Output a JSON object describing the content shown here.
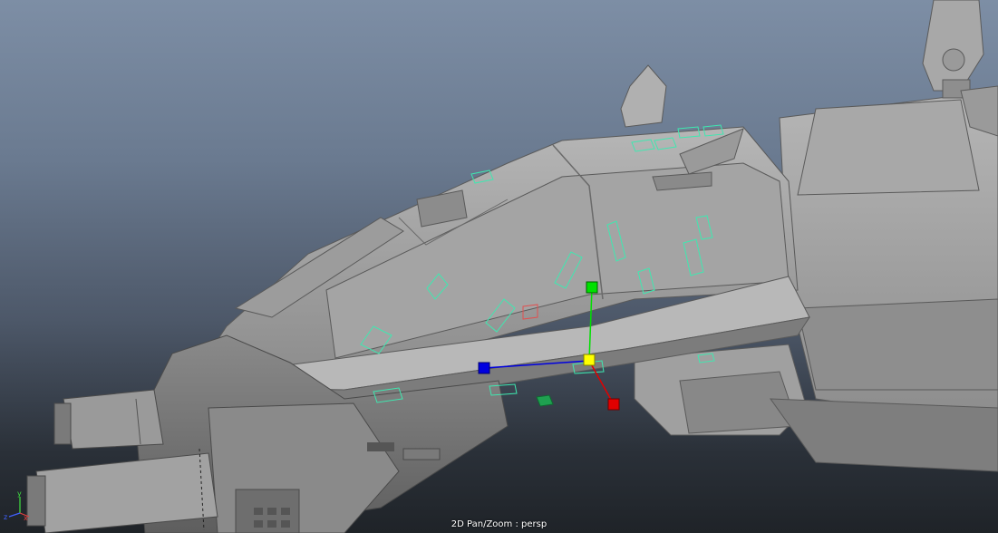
{
  "viewport": {
    "camera_label": "2D Pan/Zoom : persp",
    "axis_labels": {
      "x": "x",
      "y": "y",
      "z": "z"
    }
  },
  "colors": {
    "background_top": "#7d8ea5",
    "background_bottom": "#1f2328",
    "mesh": "#9a9a9a",
    "mesh_light": "#b4b4b4",
    "mesh_dark": "#6e6e6e",
    "selection_wire": "#3fe8b0",
    "manip_x": "#e00000",
    "manip_y": "#00e000",
    "manip_z": "#0000e0",
    "manip_center": "#ffff00"
  },
  "icons": [
    "axis-triad-icon",
    "move-manipulator-icon"
  ]
}
